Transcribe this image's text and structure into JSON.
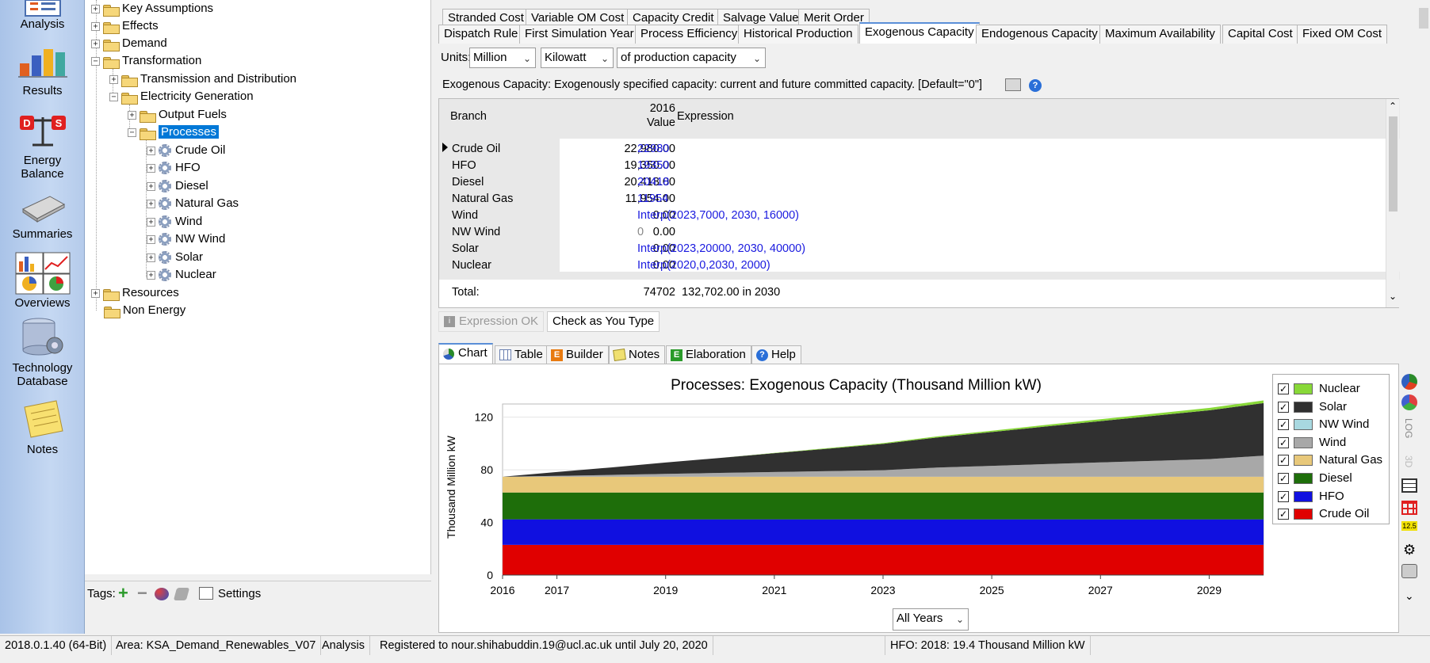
{
  "nav": {
    "items": [
      {
        "label": "Analysis"
      },
      {
        "label": "Results"
      },
      {
        "label_1": "Energy",
        "label_2": "Balance"
      },
      {
        "label": "Summaries"
      },
      {
        "label": "Overviews"
      },
      {
        "label_1": "Technology",
        "label_2": "Database"
      },
      {
        "label": "Notes"
      }
    ]
  },
  "tree": {
    "nodes": [
      {
        "label": "Key Assumptions"
      },
      {
        "label": "Effects"
      },
      {
        "label": "Demand"
      },
      {
        "label": "Transformation"
      },
      {
        "label": "Transmission and Distribution"
      },
      {
        "label": "Electricity Generation"
      },
      {
        "label": "Output Fuels"
      },
      {
        "label": "Processes"
      },
      {
        "label": "Crude Oil"
      },
      {
        "label": "HFO"
      },
      {
        "label": "Diesel"
      },
      {
        "label": "Natural Gas"
      },
      {
        "label": "Wind"
      },
      {
        "label": "NW Wind"
      },
      {
        "label": "Solar"
      },
      {
        "label": "Nuclear"
      },
      {
        "label": "Resources"
      },
      {
        "label": "Non Energy"
      }
    ]
  },
  "tags": {
    "label": "Tags:",
    "settings": "Settings"
  },
  "tabs_row1": [
    "Stranded Cost",
    "Variable OM Cost",
    "Capacity Credit",
    "Salvage Value",
    "Merit Order"
  ],
  "tabs_row2": [
    "Dispatch Rule",
    "First Simulation Year",
    "Process Efficiency",
    "Historical Production",
    "Exogenous Capacity",
    "Endogenous Capacity",
    "Maximum Availability",
    "Capital Cost",
    "Fixed OM Cost"
  ],
  "units": {
    "label": "Units:",
    "scale": "Million",
    "unit": "Kilowatt",
    "basis": "of production capacity"
  },
  "description": "Exogenous Capacity: Exogenously specified capacity: current and future committed capacity. [Default=\"0\"]",
  "grid": {
    "headers": {
      "branch": "Branch",
      "year": "2016",
      "value": "Value",
      "expression": "Expression"
    },
    "rows": [
      {
        "branch": "Crude Oil",
        "value": "22,980.00",
        "expression": "22980"
      },
      {
        "branch": "HFO",
        "value": "19,350.00",
        "expression": "19350"
      },
      {
        "branch": "Diesel",
        "value": "20,418.00",
        "expression": "20418"
      },
      {
        "branch": "Natural Gas",
        "value": "11,954.00",
        "expression": "11954"
      },
      {
        "branch": "Wind",
        "value": "0.00",
        "expression": "Interp(2023,7000, 2030, 16000)"
      },
      {
        "branch": "NW Wind",
        "value": "0.00",
        "expression": "0"
      },
      {
        "branch": "Solar",
        "value": "0.00",
        "expression": "Interp(2023,20000, 2030, 40000)"
      },
      {
        "branch": "Nuclear",
        "value": "0.00",
        "expression": "Interp(2020,0,2030, 2000)"
      }
    ],
    "total": {
      "label": "Total:",
      "value": "74702",
      "expression": "132,702.00 in 2030"
    }
  },
  "check": {
    "status": "Expression OK",
    "toggle": "Check as You Type"
  },
  "lower_tabs": [
    "Chart",
    "Table",
    "Builder",
    "Notes",
    "Elaboration",
    "Help"
  ],
  "chart_data": {
    "type": "area",
    "stacked": true,
    "title": "Processes: Exogenous Capacity (Thousand Million kW)",
    "ylabel": "Thousand Million kW",
    "xlabel": "",
    "x": [
      2016,
      2017,
      2018,
      2019,
      2020,
      2021,
      2022,
      2023,
      2024,
      2025,
      2026,
      2027,
      2028,
      2029,
      2030
    ],
    "xticks": [
      "2016",
      "2017",
      "2019",
      "2021",
      "2023",
      "2025",
      "2027",
      "2029"
    ],
    "yticks": [
      "0",
      "40",
      "80",
      "120"
    ],
    "ylim": [
      0,
      130
    ],
    "legend": "right",
    "series": [
      {
        "name": "Crude Oil",
        "color": "#e00000",
        "values": [
          22.98,
          22.98,
          22.98,
          22.98,
          22.98,
          22.98,
          22.98,
          22.98,
          22.98,
          22.98,
          22.98,
          22.98,
          22.98,
          22.98,
          22.98
        ]
      },
      {
        "name": "HFO",
        "color": "#1010e0",
        "values": [
          19.35,
          19.35,
          19.35,
          19.35,
          19.35,
          19.35,
          19.35,
          19.35,
          19.35,
          19.35,
          19.35,
          19.35,
          19.35,
          19.35,
          19.35
        ]
      },
      {
        "name": "Diesel",
        "color": "#1e6e0a",
        "values": [
          20.418,
          20.418,
          20.418,
          20.418,
          20.418,
          20.418,
          20.418,
          20.418,
          20.418,
          20.418,
          20.418,
          20.418,
          20.418,
          20.418,
          20.418
        ]
      },
      {
        "name": "Natural Gas",
        "color": "#e8c87a",
        "values": [
          11.954,
          11.954,
          11.954,
          11.954,
          11.954,
          11.954,
          11.954,
          11.954,
          11.954,
          11.954,
          11.954,
          11.954,
          11.954,
          11.954,
          11.954
        ]
      },
      {
        "name": "Wind",
        "color": "#a8a8a8",
        "values": [
          0,
          0.7,
          1.4,
          2.2,
          2.9,
          3.6,
          4.3,
          5.0,
          7.0,
          8.3,
          9.6,
          10.9,
          12.1,
          13.4,
          16.0
        ]
      },
      {
        "name": "NW Wind",
        "color": "#a8d8e0",
        "values": [
          0,
          0,
          0,
          0,
          0,
          0,
          0,
          0,
          0,
          0,
          0,
          0,
          0,
          0,
          0
        ]
      },
      {
        "name": "Solar",
        "color": "#303030",
        "values": [
          0,
          2.9,
          5.7,
          8.6,
          11.4,
          14.3,
          17.1,
          20.0,
          22.9,
          25.7,
          28.6,
          31.4,
          34.3,
          37.1,
          40.0
        ]
      },
      {
        "name": "Nuclear",
        "color": "#88d838",
        "values": [
          0,
          0,
          0,
          0,
          0,
          0.2,
          0.4,
          0.6,
          0.8,
          1.0,
          1.2,
          1.4,
          1.6,
          1.8,
          2.0
        ]
      }
    ]
  },
  "years_select": "All Years",
  "status": {
    "version": "2018.0.1.40 (64-Bit)",
    "area": "Area: KSA_Demand_Renewables_V07",
    "view": "Analysis",
    "registered": "Registered to nour.shihabuddin.19@ucl.ac.uk until July 20, 2020",
    "hint": "HFO: 2018: 19.4 Thousand Million kW"
  },
  "side_tools": {
    "log": "LOG",
    "3d": "3D",
    "badge": "12.5"
  }
}
